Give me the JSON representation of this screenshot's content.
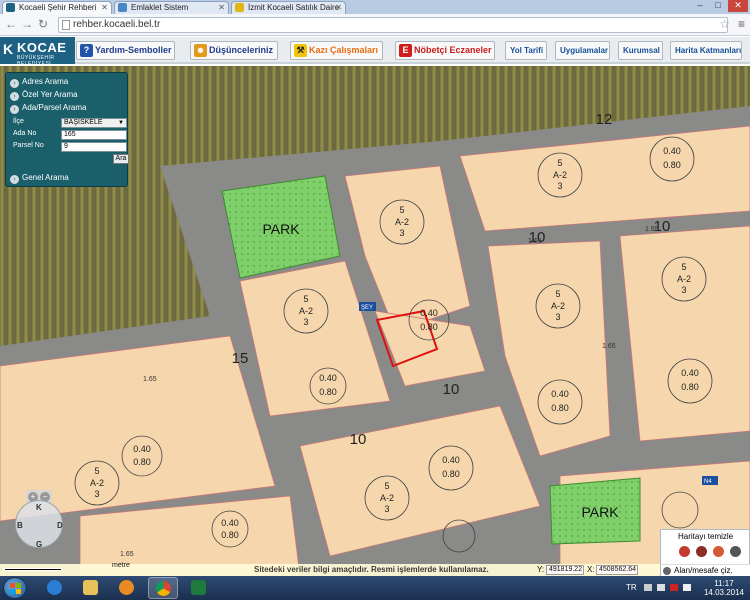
{
  "browser": {
    "tabs": [
      {
        "label": "Kocaeli Şehir Rehberi",
        "favicon_color": "#1d6283"
      },
      {
        "label": "Emlaklet Sistem",
        "favicon_color": "#4a86c5"
      },
      {
        "label": "İzmit Kocaeli Satılık Daire",
        "favicon_color": "#e1b70f"
      }
    ],
    "url": "rehber.kocaeli.bel.tr",
    "window_controls": [
      "–",
      "□",
      "✕"
    ]
  },
  "header": {
    "logo_mark": "K",
    "logo_text": "KOCAE",
    "logo_sub": "BÜYÜKŞEHİR BELEDİYESİ",
    "buttons": [
      {
        "label": "Yardım-Semboller",
        "style": "blue",
        "icon": "question-icon",
        "icon_color": "#2255aa",
        "glyph": "?"
      },
      {
        "label": "Düşünceleriniz",
        "style": "blue",
        "icon": "chat-icon",
        "icon_color": "#e39a1a",
        "glyph": "☻"
      },
      {
        "label": "Kazı Çalışmaları",
        "style": "orange",
        "icon": "excavation-icon",
        "icon_color": "#f2c40f",
        "glyph": "⚒"
      },
      {
        "label": "Nöbetçi Eczaneler",
        "style": "red",
        "icon": "pharmacy-icon",
        "icon_color": "#d01c1c",
        "glyph": "E"
      },
      {
        "label": "Yol Tarifi",
        "style": "small"
      },
      {
        "label": "Uygulamalar",
        "style": "small"
      },
      {
        "label": "Kurumsal",
        "style": "small"
      },
      {
        "label": "Harita Katmanları",
        "style": "small"
      }
    ]
  },
  "search_panel": {
    "menu": [
      "Adres Arama",
      "Özel Yer Arama",
      "Ada/Parsel Arama"
    ],
    "fields": {
      "ilce_label": "İlçe",
      "ilce_value": "BAŞİSKELE",
      "ada_label": "Ada No",
      "ada_value": "165",
      "parsel_label": "Parsel No",
      "parsel_value": "9"
    },
    "search_button": "Ara",
    "footer_item": "Genel Arama"
  },
  "map": {
    "labels": {
      "park1": "PARK",
      "park2": "PARK",
      "road12": "12",
      "road15": "15",
      "road10": "10",
      "sey": "ŞEY",
      "gap": "5",
      "zone": "A-2",
      "floors": "3",
      "ratio_top": "0.40",
      "ratio_bot": "0.80",
      "interval": "1.65",
      "marker": "N4"
    },
    "nav": {
      "north": "K",
      "south": "G",
      "east": "D",
      "west": "B"
    }
  },
  "status_bar": {
    "notice": "Sitedeki veriler bilgi amaçlıdır. Resmi işlemlerde kullanılamaz.",
    "y_label": "Y:",
    "y_value": "491819.22",
    "x_label": "X:",
    "x_value": "4508562.64",
    "scale_label": "metre"
  },
  "map_tools": {
    "title": "Haritayı temizle",
    "measure": "Alan/mesafe çiz."
  },
  "taskbar": {
    "language": "TR",
    "time": "11:17",
    "date": "14.03.2014"
  }
}
